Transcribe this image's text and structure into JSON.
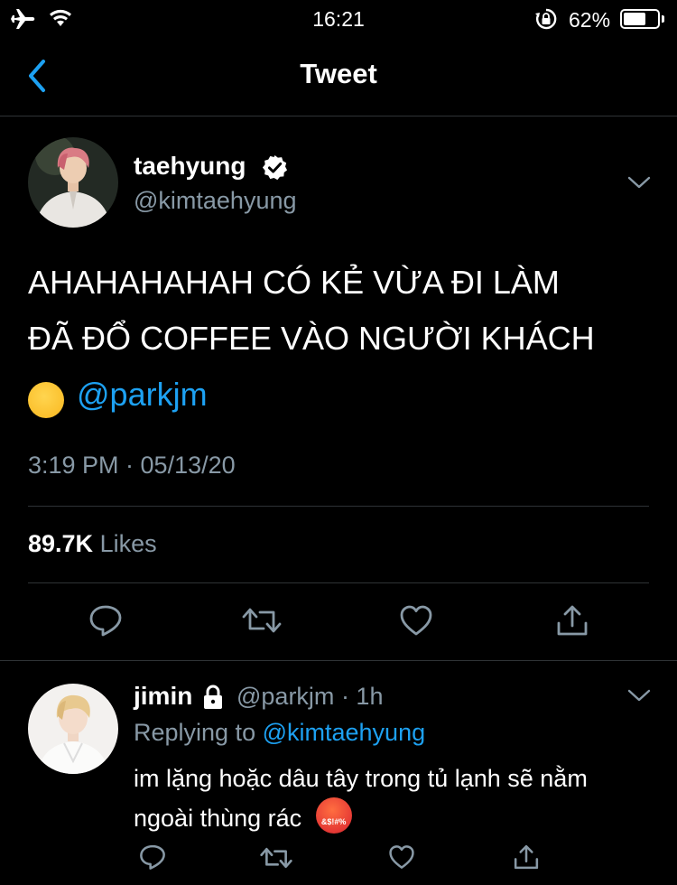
{
  "status_bar": {
    "time": "16:21",
    "battery": "62%"
  },
  "nav": {
    "title": "Tweet"
  },
  "tweet": {
    "author_name": "taehyung",
    "author_handle": "@kimtaehyung",
    "text_line1": "AHAHAHAHAH CÓ KẺ VỪA ĐI LÀM",
    "text_line2": "ĐÃ ĐỔ COFFEE VÀO NGƯỜI KHÁCH",
    "emoji": "😏",
    "mention": "@parkjm",
    "timestamp": "3:19 PM · 05/13/20",
    "likes_count": "89.7K",
    "likes_label": "Likes"
  },
  "reply": {
    "author_name": "jimin",
    "author_handle": "@parkjm",
    "time_ago": "· 1h",
    "replying_label": "Replying to",
    "replying_to": "@kimtaehyung",
    "text_line1": "im lặng hoặc dâu tây trong tủ lạnh sẽ nằm",
    "text_line2": "ngoài thùng rác",
    "emoji_text": "&$!#%"
  },
  "colors": {
    "accent": "#1da1f2",
    "muted": "#8899a6",
    "divider": "#2f3336",
    "background": "#000000"
  },
  "icons": [
    "airplane-icon",
    "wifi-icon",
    "orientation-lock-icon",
    "battery-icon",
    "back-chevron-icon",
    "verified-badge-icon",
    "chevron-down-icon",
    "reply-icon",
    "retweet-icon",
    "like-icon",
    "share-icon",
    "lock-icon"
  ]
}
